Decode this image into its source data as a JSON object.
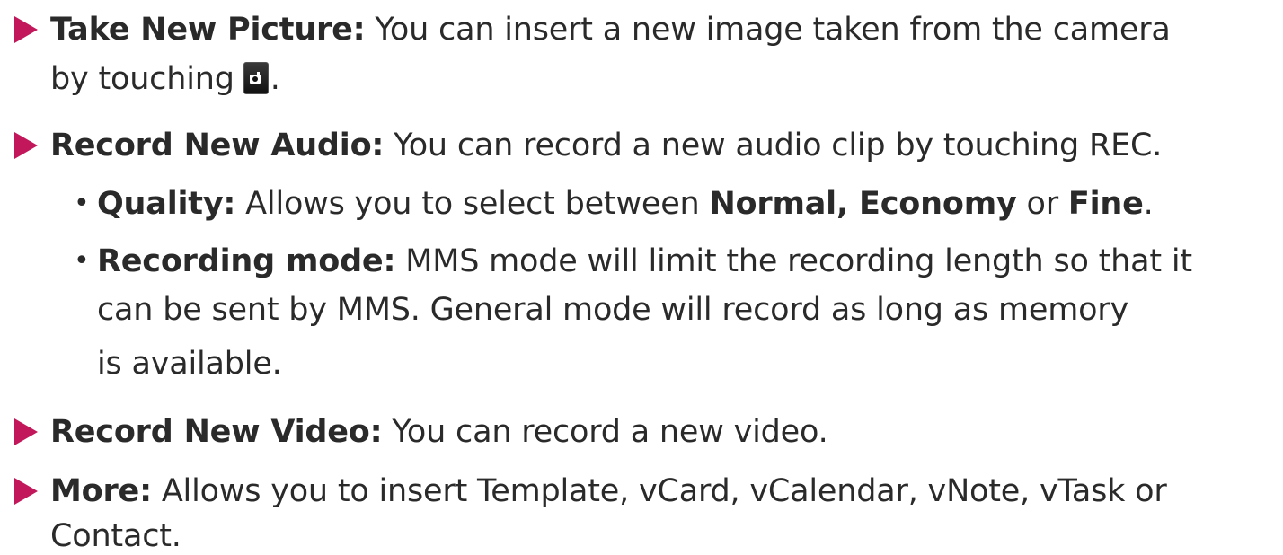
{
  "items": {
    "take_picture": {
      "title": "Take New Picture:",
      "line1": "You can insert a new image taken from the camera",
      "line2_before_icon": "by touching",
      "line2_after_icon": ".",
      "icon": "camera-icon"
    },
    "record_audio": {
      "title": "Record New Audio:",
      "text": "You can record a new audio clip by touching REC.",
      "sub_quality": {
        "bullet": "•",
        "title": "Quality:",
        "text_before": "Allows you to select between",
        "option_normal_economy": "Normal, Economy",
        "text_or": "or",
        "option_fine": "Fine",
        "end": "."
      },
      "sub_recording_mode": {
        "bullet": "•",
        "title": "Recording mode:",
        "line1": "MMS mode will limit the recording length so that it",
        "line2": "can be sent by MMS. General mode will record as long as memory",
        "line3": "is available."
      }
    },
    "record_video": {
      "title": "Record New Video:",
      "text": "You can record a new video."
    },
    "more": {
      "title": "More:",
      "line1": "Allows you to insert Template, vCard, vCalendar, vNote, vTask or",
      "line2": "Contact."
    }
  },
  "colors": {
    "arrow": "#c2185b",
    "text": "#2a2a2a"
  }
}
